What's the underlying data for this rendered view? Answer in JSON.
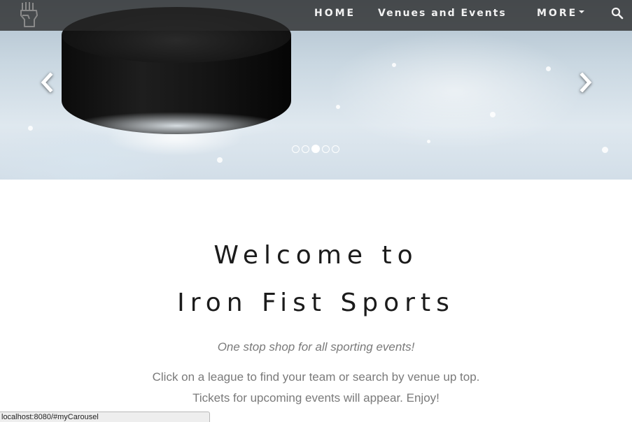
{
  "navbar": {
    "brand_icon": "raised-fist-icon",
    "items": [
      {
        "label": "HOME"
      },
      {
        "label": "Venues and Events"
      },
      {
        "label": "MORE"
      }
    ],
    "search_icon": "search-icon"
  },
  "carousel": {
    "slide_image": "hockey puck on ice",
    "prev_icon": "chevron-left-icon",
    "next_icon": "chevron-right-icon",
    "indicator_count": 5,
    "active_index": 2
  },
  "main": {
    "heading_line1": "Welcome to",
    "heading_line2": "Iron Fist Sports",
    "tagline": "One stop shop for all sporting events!",
    "description": "Click on a league to find your team or search by venue up top. Tickets for upcoming events will appear. Enjoy!"
  },
  "status_bar": {
    "url": "localhost:8080/#myCarousel"
  },
  "colors": {
    "navbar_bg": "#282828",
    "nav_text": "#f2f2f2",
    "heading_text": "#1b1b1b",
    "body_text": "#7a7a7a"
  }
}
